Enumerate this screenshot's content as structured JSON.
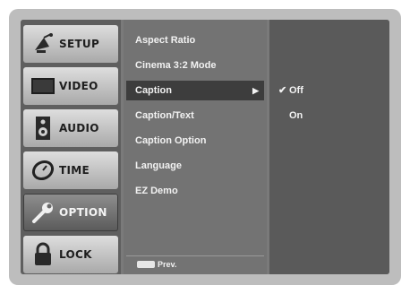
{
  "sidebar": {
    "items": [
      {
        "label": "SETUP",
        "icon": "satellite-dish-icon"
      },
      {
        "label": "VIDEO",
        "icon": "tv-icon"
      },
      {
        "label": "AUDIO",
        "icon": "speaker-icon"
      },
      {
        "label": "TIME",
        "icon": "clock-icon"
      },
      {
        "label": "OPTION",
        "icon": "wrench-icon"
      },
      {
        "label": "LOCK",
        "icon": "padlock-icon"
      }
    ],
    "active_index": 4
  },
  "submenu": {
    "items": [
      {
        "label": "Aspect Ratio"
      },
      {
        "label": "Cinema 3:2 Mode"
      },
      {
        "label": "Caption",
        "arrow": "▶"
      },
      {
        "label": "Caption/Text"
      },
      {
        "label": "Caption Option"
      },
      {
        "label": "Language"
      },
      {
        "label": "EZ Demo"
      }
    ],
    "selected_index": 2,
    "footer": {
      "key_label": "MENU",
      "text": "Prev."
    }
  },
  "options": {
    "items": [
      {
        "label": "Off",
        "checked": true,
        "check_mark": "✔"
      },
      {
        "label": "On",
        "checked": false,
        "check_mark": ""
      }
    ]
  }
}
